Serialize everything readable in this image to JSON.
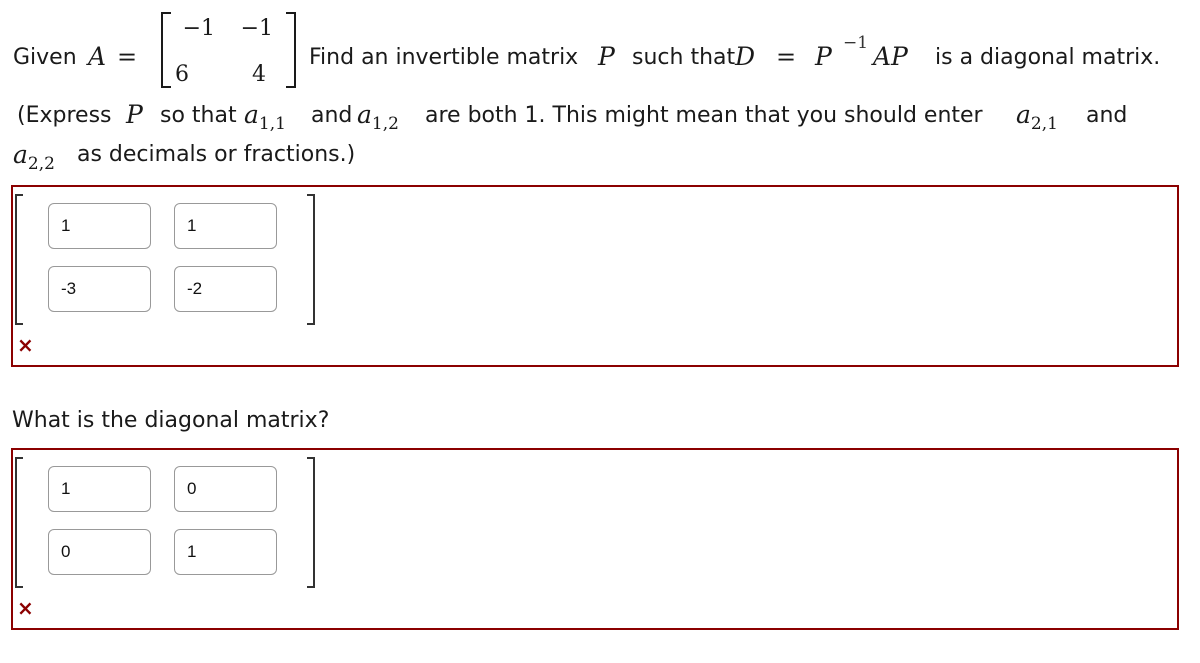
{
  "question1": {
    "given_label": "Given",
    "matrix_name": "A",
    "equals": "=",
    "matrix_A": [
      [
        "−1",
        "−1"
      ],
      [
        "6",
        "4"
      ]
    ],
    "find_text": "Find an invertible matrix",
    "P": "P",
    "such_that": "such that",
    "D": "D",
    "P_inv_sup": "−1",
    "AP": "AP",
    "tail": "is a diagonal matrix.",
    "instruction": {
      "open": "(Express",
      "so_that": "so that",
      "a": "a",
      "sub11": "1,1",
      "and1": "and",
      "sub12": "1,2",
      "mid": "are both 1.  This might mean that you should enter",
      "sub21": "2,1",
      "and2": "and",
      "sub22": "2,2",
      "end": "as decimals or fractions.)"
    }
  },
  "answer1": {
    "inputs": [
      [
        "1",
        "1"
      ],
      [
        "-3",
        "-2"
      ]
    ],
    "status": "incorrect",
    "status_icon": "×"
  },
  "question2": {
    "prompt": "What is the diagonal matrix?"
  },
  "answer2": {
    "inputs": [
      [
        "1",
        "0"
      ],
      [
        "0",
        "1"
      ]
    ],
    "status": "incorrect",
    "status_icon": "×"
  },
  "colors": {
    "error_border": "#8b0000",
    "error_icon": "#8b0000"
  }
}
